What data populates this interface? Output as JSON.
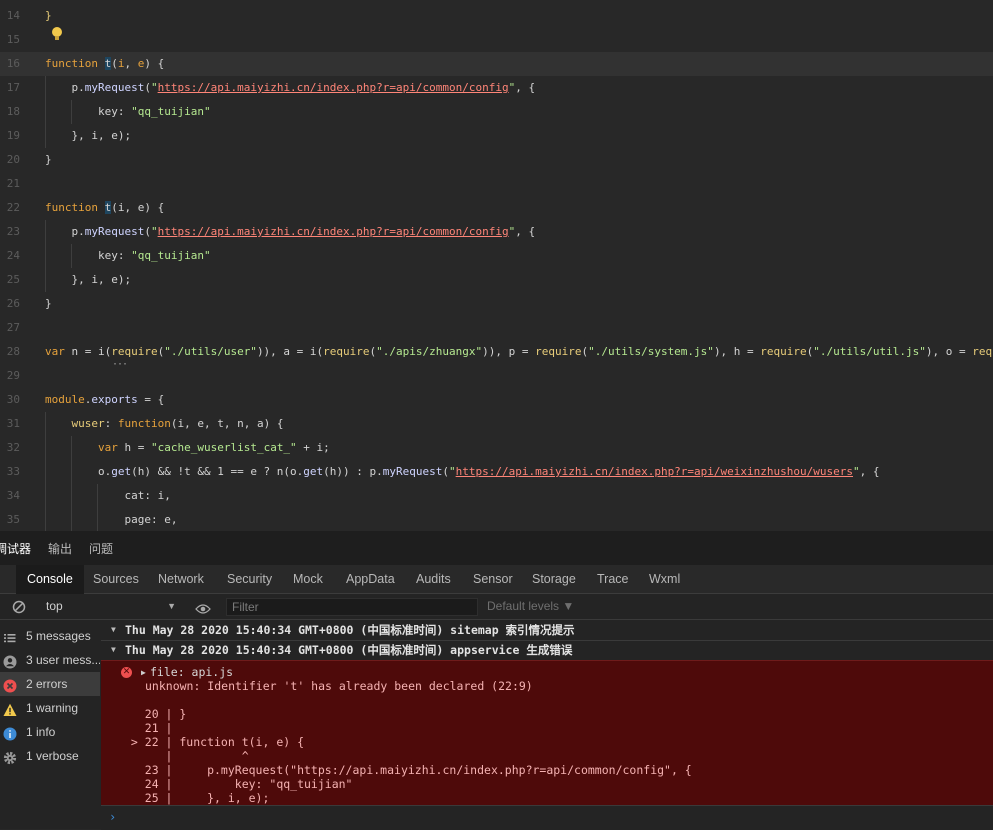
{
  "editor": {
    "lines": [
      {
        "n": "14",
        "code": "}"
      },
      {
        "n": "15",
        "code": ""
      },
      {
        "n": "16",
        "code": "function t(i, e) {"
      },
      {
        "n": "17",
        "code": "    p.myRequest(\"https://api.maiyizhi.cn/index.php?r=api/common/config\", {"
      },
      {
        "n": "18",
        "code": "        key: \"qq_tuijian\""
      },
      {
        "n": "19",
        "code": "    }, i, e);"
      },
      {
        "n": "20",
        "code": "}"
      },
      {
        "n": "21",
        "code": ""
      },
      {
        "n": "22",
        "code": "function t(i, e) {"
      },
      {
        "n": "23",
        "code": "    p.myRequest(\"https://api.maiyizhi.cn/index.php?r=api/common/config\", {"
      },
      {
        "n": "24",
        "code": "        key: \"qq_tuijian\""
      },
      {
        "n": "25",
        "code": "    }, i, e);"
      },
      {
        "n": "26",
        "code": "}"
      },
      {
        "n": "27",
        "code": ""
      },
      {
        "n": "28",
        "code": "var n = i(require(\"./utils/user\")), a = i(require(\"./apis/zhuangx\")), p = require(\"./utils/system.js\"), h = require(\"./utils/util.js\"), o = requ"
      },
      {
        "n": "29",
        "code": ""
      },
      {
        "n": "30",
        "code": "module.exports = {"
      },
      {
        "n": "31",
        "code": "    wuser: function(i, e, t, n, a) {"
      },
      {
        "n": "32",
        "code": "        var h = \"cache_wuserlist_cat_\" + i;"
      },
      {
        "n": "33",
        "code": "        o.get(h) && !t && 1 == e ? n(o.get(h)) : p.myRequest(\"https://api.maiyizhi.cn/index.php?r=api/weixinzhushou/wusers\", {"
      },
      {
        "n": "34",
        "code": "            cat: i,"
      },
      {
        "n": "35",
        "code": "            page: e,"
      }
    ]
  },
  "panel_tabs": [
    "调试器",
    "输出",
    "问题"
  ],
  "devtools_tabs": [
    "Console",
    "Sources",
    "Network",
    "Security",
    "Mock",
    "AppData",
    "Audits",
    "Sensor",
    "Storage",
    "Trace",
    "Wxml"
  ],
  "toolbar": {
    "context": "top",
    "filter_placeholder": "Filter",
    "levels": "Default levels ▼"
  },
  "sidebar": [
    {
      "label": "5 messages",
      "icon": "list-icon"
    },
    {
      "label": "3 user mess...",
      "icon": "user-icon"
    },
    {
      "label": "2 errors",
      "icon": "error-icon"
    },
    {
      "label": "1 warning",
      "icon": "warning-icon"
    },
    {
      "label": "1 info",
      "icon": "info-icon"
    },
    {
      "label": "1 verbose",
      "icon": "gear-icon"
    }
  ],
  "console": {
    "group1": "Thu May 28 2020 15:40:34 GMT+0800 (中国标准时间) sitemap 索引情况提示",
    "group2": "Thu May 28 2020 15:40:34 GMT+0800 (中国标准时间)  appservice 生成错误",
    "error_file": "file: api.js",
    "error_msg": "unknown: Identifier 't' has already been declared (22:9)",
    "snippet": [
      "   20 | }",
      "   21 |",
      " > 22 | function t(i, e) {",
      "      |          ^",
      "   23 |     p.myRequest(\"https://api.maiyizhi.cn/index.php?r=api/common/config\", {",
      "   24 |         key: \"qq_tuijian\"",
      "   25 |     }, i, e);"
    ],
    "prompt": "›"
  },
  "colors": {
    "editor_bg": "#282828",
    "keyword": "#e6a23c",
    "string": "#b5e890",
    "url": "#ff8578",
    "error_bg": "#4e0a0a",
    "error_text": "#f5b2b2",
    "error_icon": "#ef4f4f",
    "warning_icon": "#f2c94c",
    "info_icon": "#3d8bd6"
  }
}
